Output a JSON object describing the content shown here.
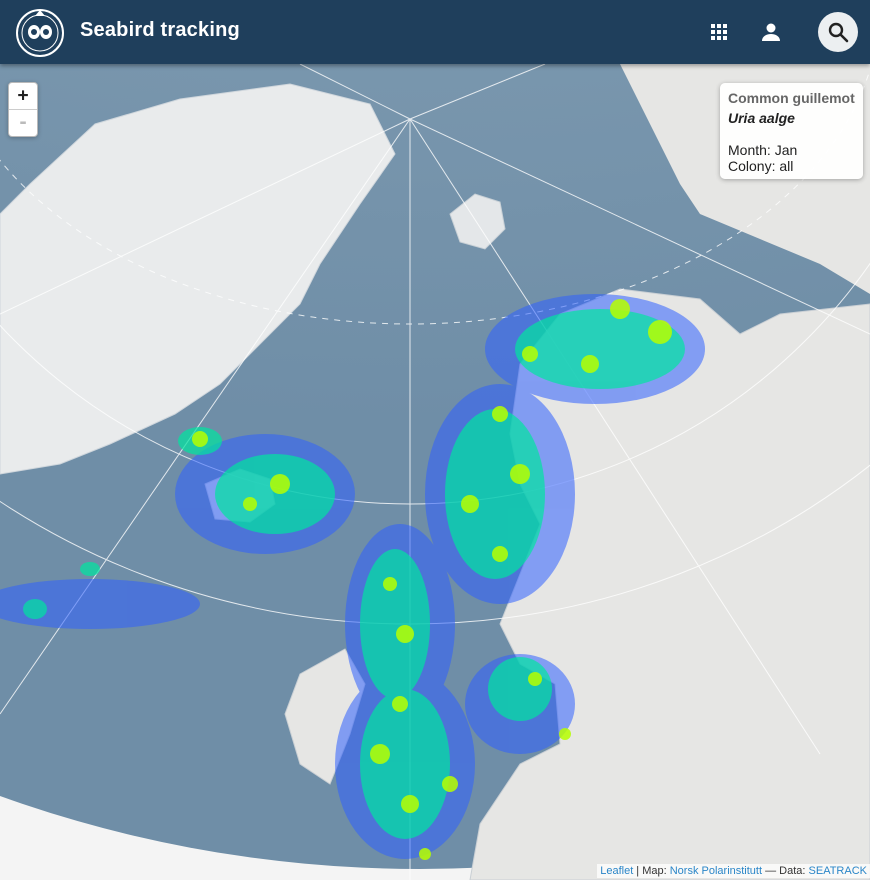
{
  "app": {
    "title": "Seabird tracking"
  },
  "header_icons": [
    "apps-grid-icon",
    "person-icon",
    "search-icon"
  ],
  "map": {
    "zoom_in_label": "+",
    "zoom_out_label": "-",
    "info": {
      "species_common": "Common guillemot",
      "species_latin": "Uria aalge",
      "month_line": "Month: Jan",
      "colony_line": "Colony: all"
    },
    "attribution": {
      "leaflet": "Leaflet",
      "sep1": " | Map: ",
      "map_source": "Norsk Polarinstitutt",
      "sep2": " — Data: ",
      "data_source": "SEATRACK"
    }
  },
  "colors": {
    "appbar": "#1f3f5c",
    "ocean": "#8ea9bd",
    "land": "#e6e6e4",
    "heat_low": "#3060ff",
    "heat_mid": "#00e5a0",
    "heat_high": "#b6ff00"
  }
}
